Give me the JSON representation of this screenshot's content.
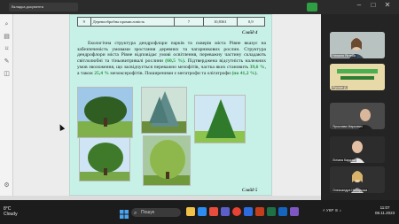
{
  "topbar": {
    "tab_title": "Вкладка документа",
    "window_controls": [
      "–",
      "□",
      "✕"
    ]
  },
  "document": {
    "table_rows": [
      [
        "9",
        "Деревообробна промисловість",
        "7",
        "10,8361",
        "0,9"
      ]
    ],
    "slide_label_top": "Слайд 4",
    "paragraph": {
      "part1": "Екологічна структура дендрофлори парків та скверів міста Рівне вказує на забезпеченість умовами зростання деревних та чагарникових рослин. Структура дендрофлори міста Рівне відповідає умові освітлення, переважну частину складають світлолюбні та тіньовитривалі рослини ",
      "hl1": "(60,5 %).",
      "part2": " Підтверджена відсутність належних умов зволоження, що засвідчується переважно мезофітів, частка яких становить ",
      "hl2": "39,6 %",
      "part3": ", а також ",
      "hl3": "25,4 %",
      "part4": " мезоксерофітів. Поширеними є мегатрофи та олігатрофи ",
      "hl4": "(по 41,2 %)."
    },
    "slide_label_bottom": "Слайд 5"
  },
  "participants": [
    {
      "name": "Наталія Ястеба"
    },
    {
      "name": "Руслан Д."
    },
    {
      "name": "Ярослава Маркович"
    },
    {
      "name": "Ліліана Кардаш"
    },
    {
      "name": "Олександра Неборська"
    }
  ],
  "taskbar": {
    "temperature": "8°C",
    "weather": "Cloudy",
    "search_placeholder": "Пошук",
    "tray_lang": "УКР",
    "time": "11:07",
    "date": "08.11.2023"
  }
}
